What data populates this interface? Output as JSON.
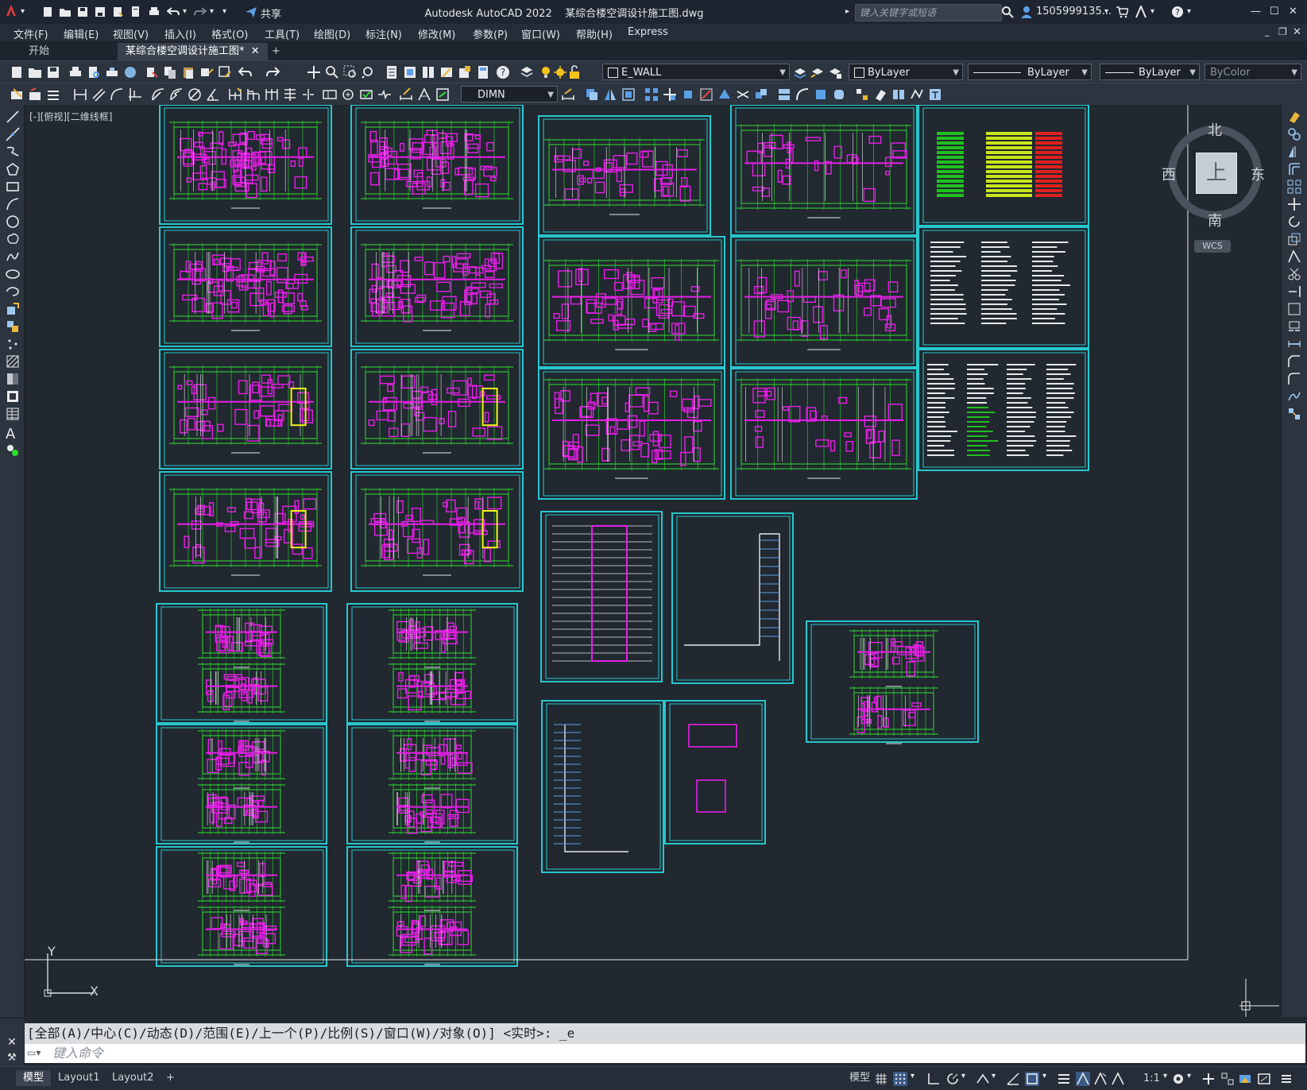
{
  "window": {
    "app_title": "Autodesk AutoCAD 2022",
    "file_title": "某综合楼空调设计施工图.dwg",
    "share_label": "共享",
    "search_placeholder": "键入关键字或短语",
    "user_name": "1505999135...",
    "help": "?"
  },
  "menu": {
    "items": [
      "文件(F)",
      "编辑(E)",
      "视图(V)",
      "插入(I)",
      "格式(O)",
      "工具(T)",
      "绘图(D)",
      "标注(N)",
      "修改(M)",
      "参数(P)",
      "窗口(W)",
      "帮助(H)",
      "Express"
    ]
  },
  "tabs": {
    "start": "开始",
    "active_doc": "某综合楼空调设计施工图*",
    "close": "✕",
    "add": "+"
  },
  "toolbar": {
    "layer_name": "E_WALL",
    "color_value": "ByLayer",
    "linetype_value": "ByLayer",
    "lineweight_value": "ByLayer",
    "plotstyle_value": "ByColor",
    "dimstyle_value": "DIMN"
  },
  "viewport": {
    "label": "[-][俯视][二维线框]"
  },
  "viewcube": {
    "north": "北",
    "south": "南",
    "east": "东",
    "west": "西",
    "top_face": "上",
    "wcs": "WCS"
  },
  "ucs": {
    "x": "X",
    "y": "Y"
  },
  "command": {
    "history": "[全部(A)/中心(C)/动态(D)/范围(E)/上一个(P)/比例(S)/窗口(W)/对象(O)] <实时>: _e",
    "placeholder": "键入命令"
  },
  "status": {
    "model_tab": "模型",
    "layout1": "Layout1",
    "layout2": "Layout2",
    "add": "+",
    "model_space": "模型",
    "scale": "1:1"
  },
  "colors": {
    "sheet_border": "#27c7cf",
    "canvas_bg": "#212830",
    "grid_green": "#2fe02f",
    "wall_magenta": "#e61ee6",
    "accent_yellow": "#f4f41a"
  }
}
